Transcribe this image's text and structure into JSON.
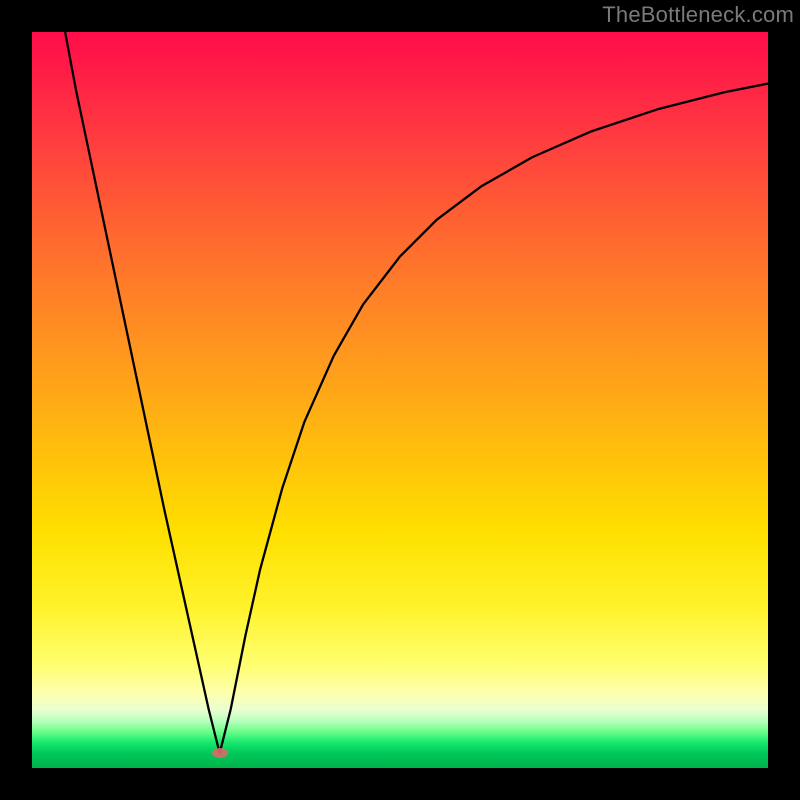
{
  "watermark_text": "TheBottleneck.com",
  "chart_data": {
    "type": "line",
    "title": "",
    "xlabel": "",
    "ylabel": "",
    "xlim": [
      0,
      100
    ],
    "ylim": [
      0,
      100
    ],
    "grid": false,
    "legend": false,
    "background_gradient": {
      "direction": "vertical",
      "stops": [
        {
          "pos": 0.0,
          "color": "#ff0d4a"
        },
        {
          "pos": 0.24,
          "color": "#ff5c34"
        },
        {
          "pos": 0.47,
          "color": "#ffa11a"
        },
        {
          "pos": 0.68,
          "color": "#ffe000"
        },
        {
          "pos": 0.86,
          "color": "#ffff70"
        },
        {
          "pos": 0.92,
          "color": "#ecffd0"
        },
        {
          "pos": 0.96,
          "color": "#18e86e"
        },
        {
          "pos": 1.0,
          "color": "#00b24a"
        }
      ]
    },
    "annotations": [
      {
        "type": "marker",
        "x": 25.5,
        "y": 2,
        "color": "#d86a6a",
        "shape": "ellipse"
      }
    ],
    "series": [
      {
        "name": "bottleneck-curve",
        "x": [
          4.5,
          6,
          8,
          10,
          12,
          14,
          16,
          18,
          20,
          22,
          24,
          25.5,
          27,
          29,
          31,
          34,
          37,
          41,
          45,
          50,
          55,
          61,
          68,
          76,
          85,
          94,
          100
        ],
        "y": [
          100,
          92,
          82.5,
          73,
          63.5,
          54,
          44.5,
          35,
          26,
          17,
          8,
          2,
          8,
          18,
          27,
          38,
          47,
          56,
          63,
          69.5,
          74.5,
          79,
          83,
          86.5,
          89.5,
          91.8,
          93
        ]
      }
    ],
    "minimum_point": {
      "x": 25.5,
      "y": 2
    }
  }
}
